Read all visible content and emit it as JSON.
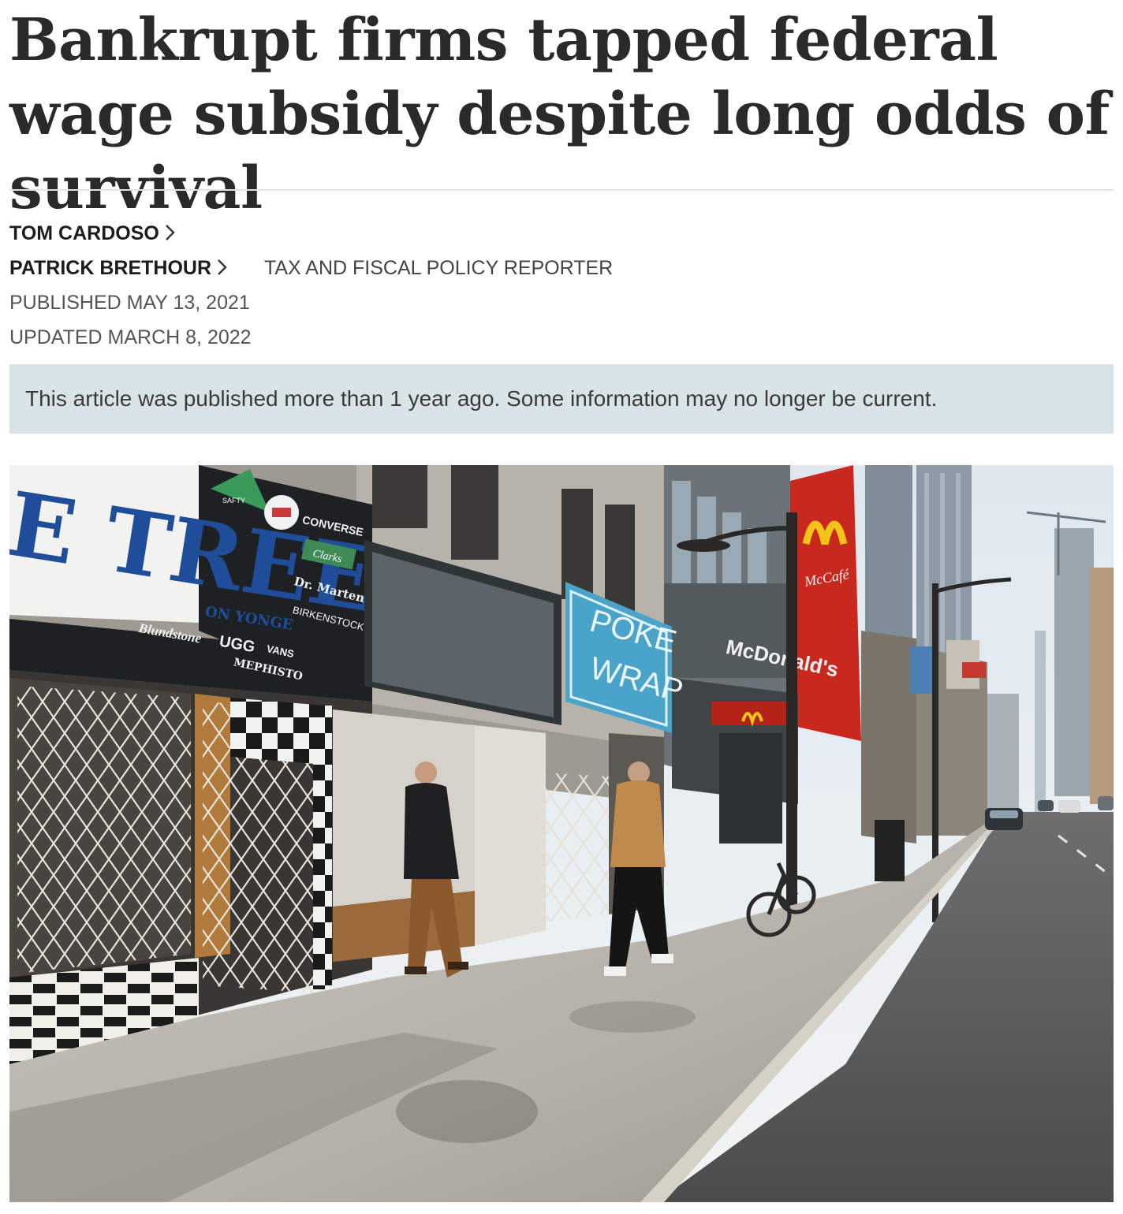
{
  "article": {
    "headline": "Bankrupt firms tapped federal wage subsidy despite long odds of survival",
    "authors": [
      {
        "name": "TOM CARDOSO",
        "role": ""
      },
      {
        "name": "PATRICK BRETHOUR",
        "role": "TAX AND FISCAL POLICY REPORTER"
      }
    ],
    "published": "PUBLISHED MAY 13, 2021",
    "updated": "UPDATED MARCH 8, 2022",
    "notice": "This article was published more than 1 year ago. Some information may no longer be current."
  },
  "photo": {
    "signs": {
      "tree_store": "E TREE",
      "tree_sub": "ON YONGE",
      "brands": [
        "CONVERSE",
        "Clarks",
        "Dr. Martens",
        "BIRKENSTOCK",
        "Blundstone",
        "UGG",
        "VANS",
        "MEPHISTO"
      ],
      "poke": "POKE",
      "wrap": "WRAP",
      "mcdonalds": "McDonald's",
      "mccafe": "McCafé",
      "safety": "SAFTY"
    }
  },
  "icons": {
    "author_chevron": "chevron-right-icon"
  },
  "colors": {
    "notice_bg": "#d9e4e8",
    "mcdonalds_red": "#c8281e",
    "poke_blue": "#4aa3c9"
  }
}
